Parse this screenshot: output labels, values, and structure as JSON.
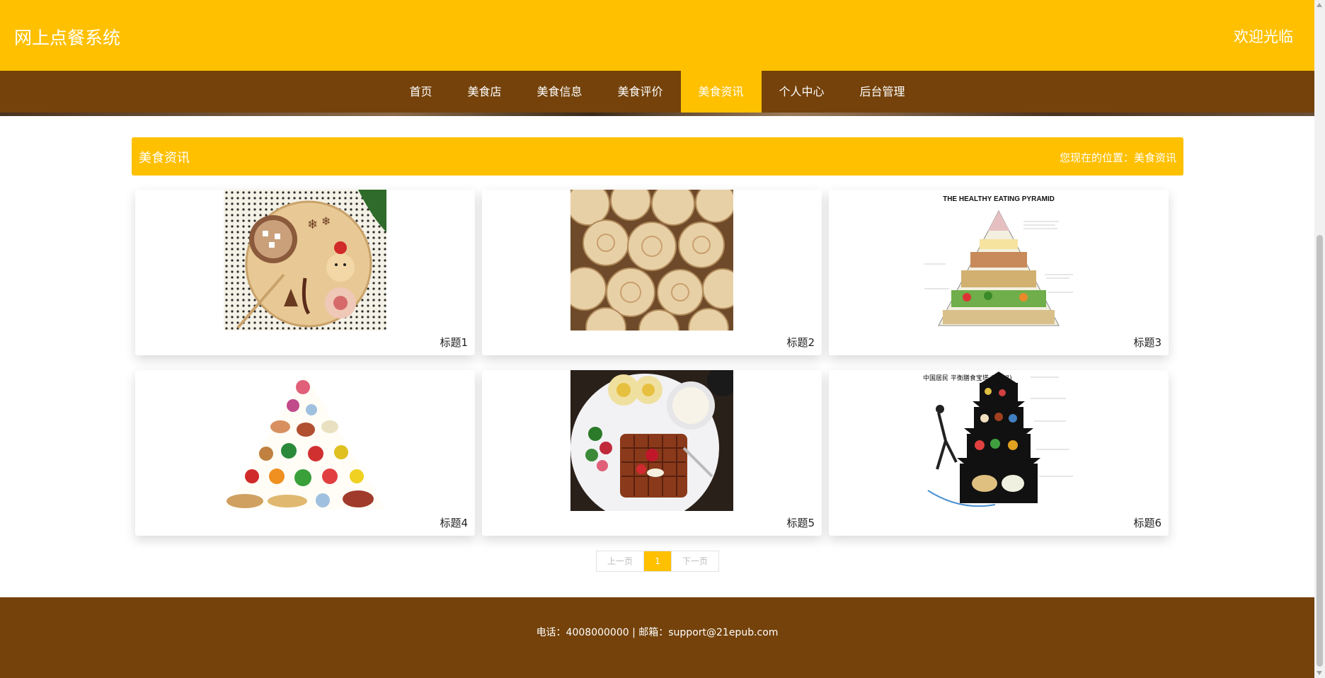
{
  "header": {
    "site_title": "网上点餐系统",
    "welcome": "欢迎光临"
  },
  "nav": {
    "items": [
      "首页",
      "美食店",
      "美食信息",
      "美食评价",
      "美食资讯",
      "个人中心",
      "后台管理"
    ],
    "active": "美食资讯"
  },
  "section": {
    "title": "美食资讯",
    "breadcrumb": "您现在的位置：美食资讯"
  },
  "cards": [
    {
      "caption": "标题1",
      "image": "holiday-snack-plate"
    },
    {
      "caption": "标题2",
      "image": "bread-rolls"
    },
    {
      "caption": "标题3",
      "image": "healthy-eating-pyramid",
      "image_text": "THE HEALTHY EATING PYRAMID"
    },
    {
      "caption": "标题4",
      "image": "food-pyramid-illustration"
    },
    {
      "caption": "标题5",
      "image": "waffle-breakfast-plate"
    },
    {
      "caption": "标题6",
      "image": "chinese-diet-pagoda",
      "image_text": "中国居民 平衡膳食宝塔 (2007)"
    }
  ],
  "pager": {
    "prev": "上一页",
    "current": "1",
    "next": "下一页"
  },
  "footer": {
    "text": "电话：4008000000 | 邮箱：support@21epub.com"
  },
  "colors": {
    "primary": "#FFC000",
    "brown": "#74420A"
  }
}
